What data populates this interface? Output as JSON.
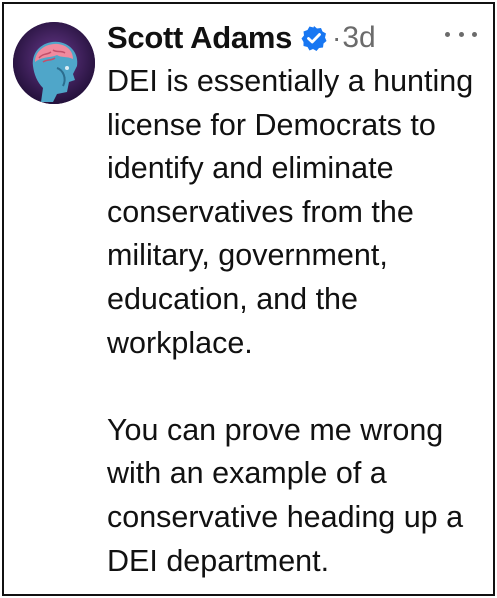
{
  "post": {
    "author": "Scott Adams",
    "separator": "·",
    "time": "3d",
    "paragraphs": [
      "DEI is essentially a hunting license for Democrats to identify and eliminate conservatives from the military, government, education, and the workplace.",
      "You can prove me wrong with an example of a conservative heading up a DEI department."
    ]
  },
  "icons": {
    "avatar": "brain-profile-icon",
    "verified": "verified-badge-icon",
    "more": "more-options-icon"
  },
  "colors": {
    "verified_badge": "#1877f2",
    "text": "#111111",
    "meta": "#6b6b6b"
  }
}
